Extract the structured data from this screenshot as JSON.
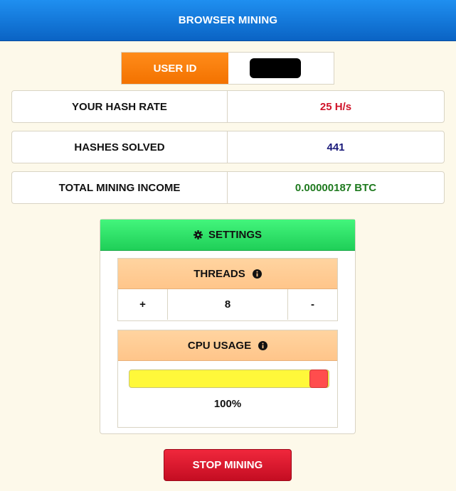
{
  "header": {
    "title": "BROWSER MINING"
  },
  "user": {
    "label": "USER ID",
    "value": ""
  },
  "stats": [
    {
      "label": "YOUR HASH RATE",
      "value": "25 H/s",
      "color": "#d0142a"
    },
    {
      "label": "HASHES SOLVED",
      "value": "441",
      "color": "#1a1a7a"
    },
    {
      "label": "TOTAL MINING INCOME",
      "value": "0.00000187 BTC",
      "color": "#1f7a1f"
    }
  ],
  "settings": {
    "title": "SETTINGS",
    "icon": "gear-icon",
    "threads": {
      "label": "THREADS",
      "plus": "+",
      "value": "8",
      "minus": "-",
      "info_icon": "info-icon"
    },
    "cpu": {
      "label": "CPU USAGE",
      "value_text": "100%",
      "level_percent": 100,
      "info_icon": "info-icon"
    }
  },
  "actions": {
    "stop_label": "STOP MINING"
  },
  "colors": {
    "header": "#0a63c4",
    "user_label": "#f37200",
    "settings_head": "#1fcf58",
    "panel_head": "#ffc58a",
    "slider_track": "#fff83a",
    "slider_handle": "#ff4d4d",
    "stop_button": "#c40d22",
    "background": "#fdf9ea"
  }
}
